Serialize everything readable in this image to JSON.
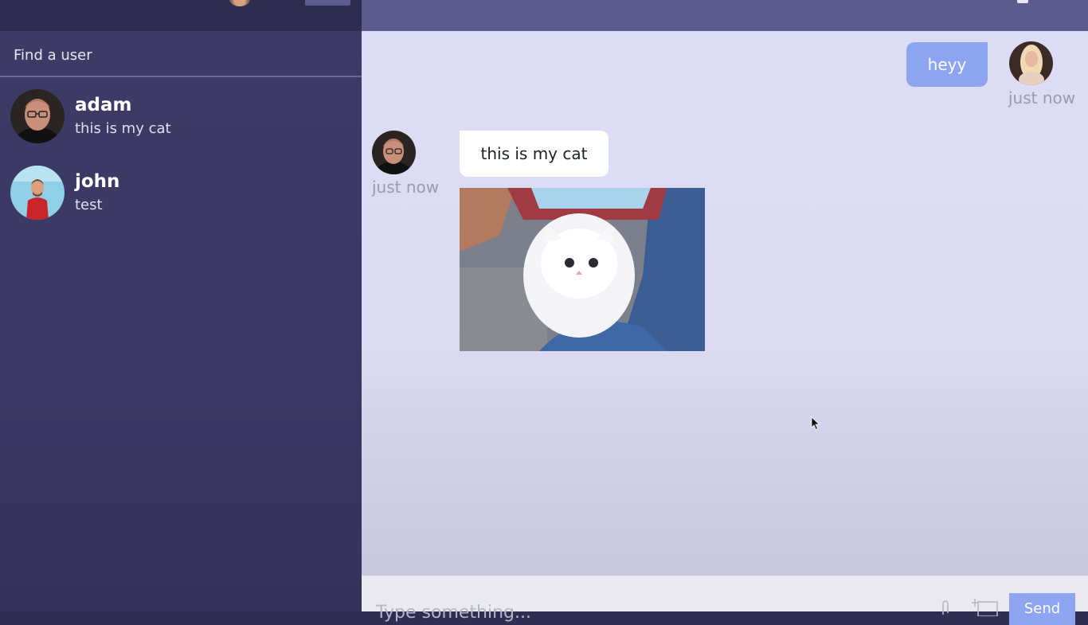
{
  "sidebar": {
    "search": {
      "placeholder": "Find a user"
    },
    "chats": [
      {
        "name": "adam",
        "last_message": "this is my cat",
        "avatar_icon": "person-glasses-avatar"
      },
      {
        "name": "john",
        "last_message": "test",
        "avatar_icon": "person-red-shirt-avatar"
      }
    ]
  },
  "chat": {
    "messages": [
      {
        "owner": true,
        "text": "heyy",
        "time": "just now"
      },
      {
        "owner": false,
        "text": "this is my cat",
        "time": "just now",
        "image_icon": "white-kitten-photo"
      }
    ],
    "input": {
      "placeholder": "Type something...",
      "send_label": "Send"
    }
  },
  "colors": {
    "sidebar_bg": "#3e3c66",
    "topbar_dark": "#2f2d4f",
    "chat_topbar": "#5d5b8d",
    "chat_bg": "#dddcf5",
    "owner_bubble": "#8da4f1",
    "other_bubble": "#ffffff"
  }
}
